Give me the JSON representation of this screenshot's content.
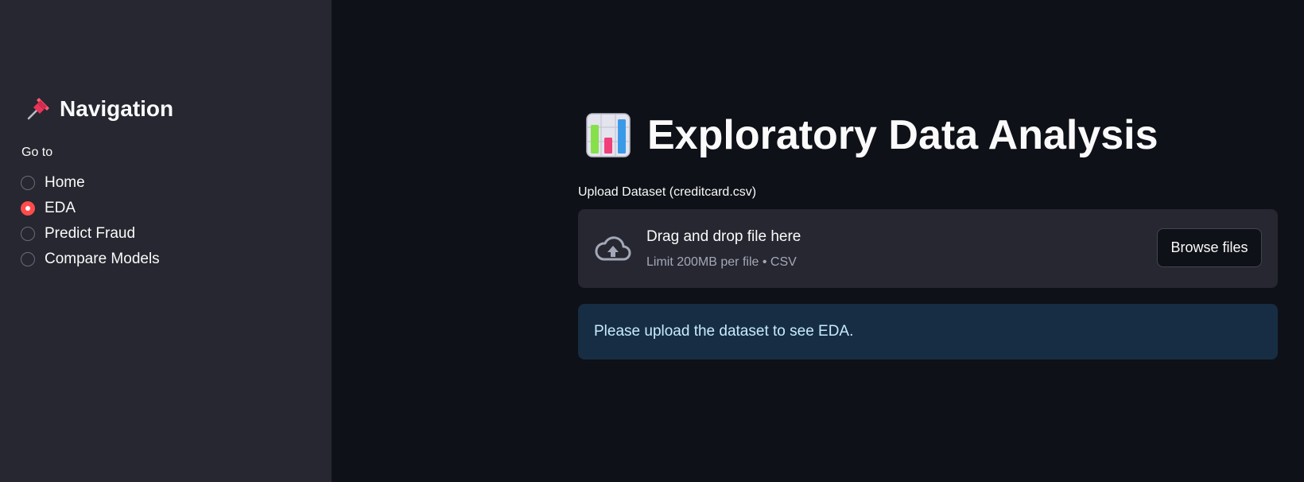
{
  "sidebar": {
    "title": "Navigation",
    "title_icon": "pushpin-icon",
    "radio_label": "Go to",
    "options": [
      {
        "label": "Home",
        "selected": false
      },
      {
        "label": "EDA",
        "selected": true
      },
      {
        "label": "Predict Fraud",
        "selected": false
      },
      {
        "label": "Compare Models",
        "selected": false
      }
    ]
  },
  "main": {
    "title": "Exploratory Data Analysis",
    "title_icon": "bar-chart-icon",
    "uploader": {
      "label": "Upload Dataset (creditcard.csv)",
      "drop_text": "Drag and drop file here",
      "limit_text": "Limit 200MB per file • CSV",
      "browse_label": "Browse files",
      "icon": "cloud-upload-icon"
    },
    "info_message": "Please upload the dataset to see EDA."
  },
  "colors": {
    "background": "#0e1117",
    "sidebar_background": "#262730",
    "accent": "#ff4b4b",
    "info_background": "#172d43",
    "info_text": "#c7ebff"
  }
}
